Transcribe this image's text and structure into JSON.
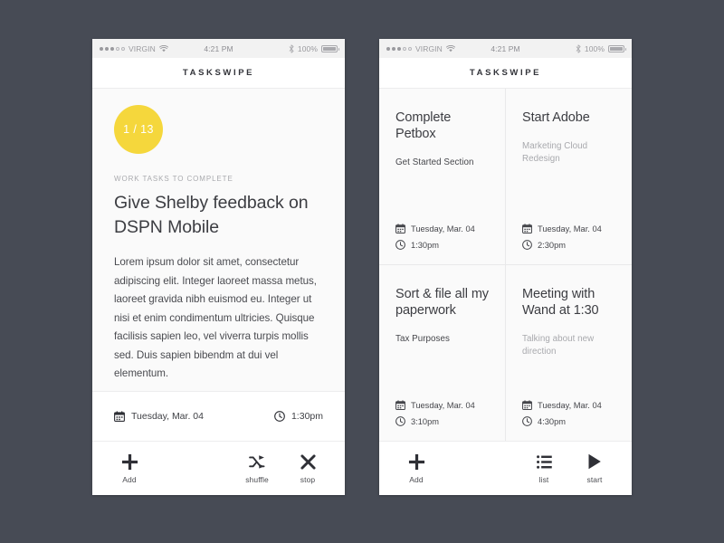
{
  "app": {
    "title": "TASKSWIPE"
  },
  "status_bar": {
    "signal_dots_filled": 3,
    "signal_dots_total": 5,
    "carrier": "VIRGIN",
    "wifi_icon": "wifi-icon",
    "time": "4:21 PM",
    "bluetooth_icon": "bluetooth-icon",
    "battery_percent": "100%",
    "battery_icon": "battery-icon"
  },
  "detail_screen": {
    "badge": "1 / 13",
    "eyebrow": "WORK TASKS TO COMPLETE",
    "heading": "Give Shelby feedback on DSPN Mobile",
    "body": "Lorem ipsum dolor sit amet, consectetur adipiscing elit. Integer laoreet massa metus, laoreet gravida nibh euismod eu. Integer ut nisi et enim condimentum ultricies. Quisque facilisis sapien leo, vel viverra turpis mollis sed. Duis sapien bibendm at dui vel elementum.",
    "meta": {
      "date_icon": "calendar-icon",
      "date": "Tuesday, Mar. 04",
      "time_icon": "clock-icon",
      "time": "1:30pm"
    },
    "toolbar": [
      {
        "icon": "plus-icon",
        "label": "Add"
      },
      {
        "icon": "shuffle-icon",
        "label": "shuffle"
      },
      {
        "icon": "close-icon",
        "label": "stop"
      }
    ]
  },
  "list_screen": {
    "cards": [
      {
        "title": "Complete Petbox",
        "subtitle": "Get Started Section",
        "subtitle_tone": "dark",
        "date_icon": "calendar-icon",
        "date": "Tuesday, Mar. 04",
        "time_icon": "clock-icon",
        "time": "1:30pm"
      },
      {
        "title": "Start Adobe",
        "subtitle": "Marketing Cloud Redesign",
        "subtitle_tone": "light",
        "date_icon": "calendar-icon",
        "date": "Tuesday, Mar. 04",
        "time_icon": "clock-icon",
        "time": "2:30pm"
      },
      {
        "title": "Sort & file all my paperwork",
        "subtitle": "Tax Purposes",
        "subtitle_tone": "dark",
        "date_icon": "calendar-icon",
        "date": "Tuesday, Mar. 04",
        "time_icon": "clock-icon",
        "time": "3:10pm"
      },
      {
        "title": "Meeting with Wand at 1:30",
        "subtitle": "Talking about new direction",
        "subtitle_tone": "light",
        "date_icon": "calendar-icon",
        "date": "Tuesday, Mar. 04",
        "time_icon": "clock-icon",
        "time": "4:30pm"
      }
    ],
    "toolbar": [
      {
        "icon": "plus-icon",
        "label": "Add"
      },
      {
        "icon": "list-icon",
        "label": "list"
      },
      {
        "icon": "play-icon",
        "label": "start"
      }
    ]
  },
  "colors": {
    "background": "#474b55",
    "accent_yellow": "#f5d73c",
    "surface": "#ffffff",
    "surface_muted": "#fafafa",
    "text_primary": "#3c3d42",
    "text_muted": "#a8a9ad"
  }
}
